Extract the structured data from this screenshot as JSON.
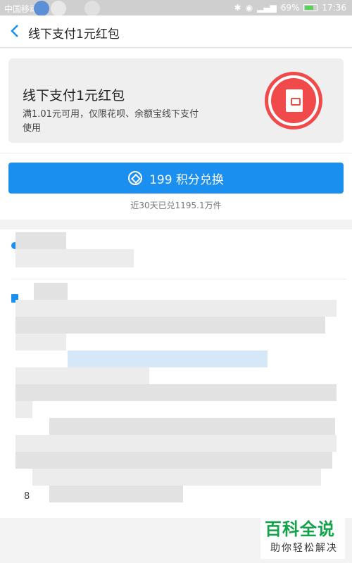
{
  "status_bar": {
    "carrier": "中国移动",
    "battery": "69%",
    "time": "17:36"
  },
  "navbar": {
    "title": "线下支付1元红包"
  },
  "card": {
    "title": "线下支付1元红包",
    "description": "满1.01元可用，仅限花呗、余额宝线下支付使用",
    "icon": "red-envelope-icon"
  },
  "exchange": {
    "button_label": "199 积分兑换",
    "sales_text": "近30天已兑1195.1万件"
  },
  "detail": {
    "footer_number": "8"
  },
  "watermark": {
    "title": "百科全说",
    "subtitle": "助你轻松解决"
  },
  "colors": {
    "accent": "#1a8ff0",
    "coupon_red": "#f14a4a",
    "watermark_green": "#12a34a"
  }
}
